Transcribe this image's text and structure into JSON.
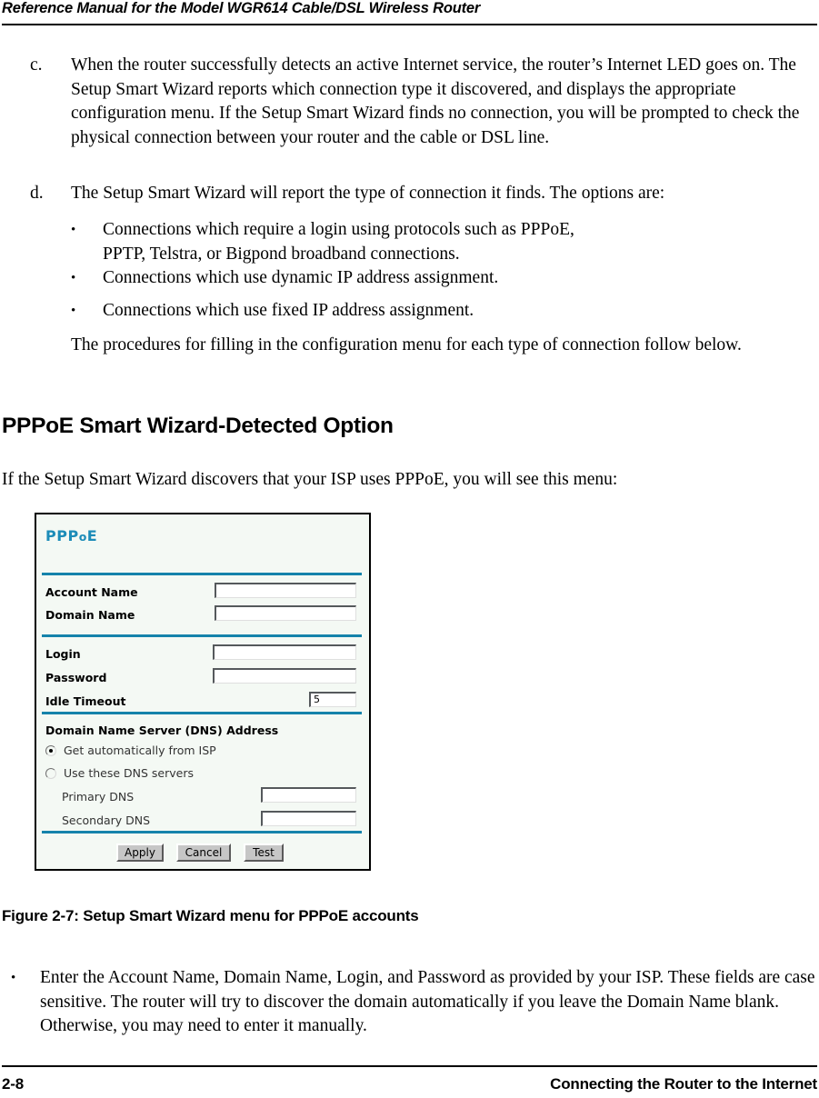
{
  "header": {
    "title": "Reference Manual for the Model WGR614 Cable/DSL Wireless Router"
  },
  "body": {
    "item_c_marker": "c.",
    "item_c_text": "When the router successfully detects an active Internet service, the router’s Internet LED goes on. The Setup Smart Wizard reports which connection type it discovered, and displays the appropriate configuration menu. If the Setup Smart Wizard finds no connection, you will be prompted to check the physical connection between your router and the cable or DSL line.",
    "item_d_marker": "d.",
    "item_d_text": "The Setup Smart Wizard will report the type of connection it finds. The options are:",
    "bullet_glyph": "•",
    "sub_bullets": [
      "Connections which require a login using protocols such as PPPoE, PPTP, Telstra, or Bigpond broadband connections.",
      "Connections which use dynamic IP address assignment.",
      "Connections which use fixed IP address assignment."
    ],
    "closing_text": "The procedures for filling in the configuration menu for each type of connection follow below.",
    "section_heading": "PPPoE Smart Wizard-Detected Option",
    "intro_text": "If the Setup Smart  Wizard discovers that your ISP uses PPPoE, you will see this menu:",
    "figure_caption": "Figure 2-7: Setup Smart Wizard menu for PPPoE accounts",
    "final_bullet": "Enter the Account Name, Domain Name, Login, and Password as provided by your ISP. These fields are case sensitive. The router will try to discover the domain automatically if you leave the Domain Name blank. Otherwise, you may need to enter it manually."
  },
  "figure": {
    "title_main": "PPP",
    "title_small_o": "o",
    "title_end": "E",
    "accent_color": "#1c8cb8",
    "divider_color": "#1583ab",
    "panel_bg": "#f4f9f4",
    "fields": {
      "account_name_label": "Account Name",
      "account_name_value": "",
      "domain_name_label": "Domain Name",
      "domain_name_value": "",
      "login_label": "Login",
      "login_value": "",
      "password_label": "Password",
      "password_value": "",
      "idle_timeout_label": "Idle Timeout",
      "idle_timeout_value": "5"
    },
    "dns": {
      "section_label": "Domain Name Server (DNS) Address",
      "radio_auto_label": "Get automatically from ISP",
      "radio_manual_label": "Use these DNS servers",
      "primary_dns_label": "Primary DNS",
      "primary_dns_value": "",
      "secondary_dns_label": "Secondary DNS",
      "secondary_dns_value": ""
    },
    "buttons": {
      "apply": "Apply",
      "cancel": "Cancel",
      "test": "Test"
    }
  },
  "footer": {
    "page_number": "2-8",
    "chapter_title": "Connecting the Router to the Internet"
  }
}
